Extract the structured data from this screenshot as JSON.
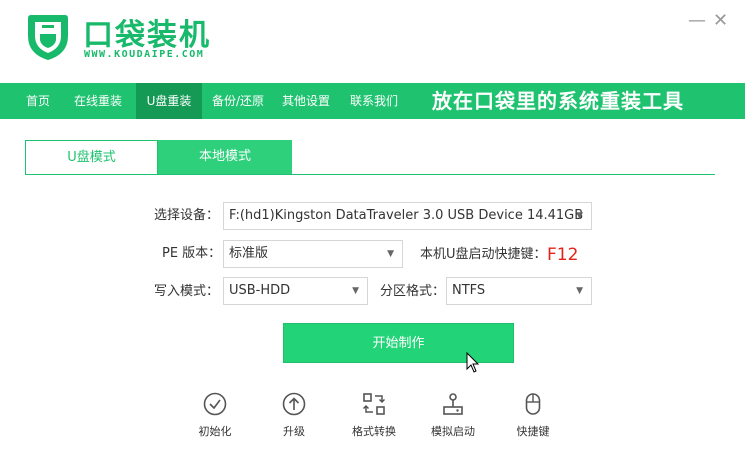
{
  "app": {
    "title": "口袋装机",
    "url": "WWW.KOUDAIPE.COM",
    "minimize_glyph": "—",
    "close_glyph": "✕"
  },
  "nav": {
    "items": [
      {
        "label": "首页"
      },
      {
        "label": "在线重装"
      },
      {
        "label": "U盘重装"
      },
      {
        "label": "备份/还原"
      },
      {
        "label": "其他设置"
      },
      {
        "label": "联系我们"
      }
    ],
    "active_index": 2,
    "slogan": "放在口袋里的系统重装工具"
  },
  "tabs": [
    {
      "label": "U盘模式"
    },
    {
      "label": "本地模式"
    }
  ],
  "form": {
    "device_label": "选择设备：",
    "device_value": "F:(hd1)Kingston DataTraveler 3.0 USB Device 14.41GB",
    "pe_label": "PE 版本：",
    "pe_value": "标准版",
    "hotkey_label": "本机U盘启动快捷键：",
    "hotkey_value": "F12",
    "write_label": "写入模式：",
    "write_value": "USB-HDD",
    "partition_label": "分区格式：",
    "partition_value": "NTFS"
  },
  "start_button": "开始制作",
  "tools": [
    {
      "label": "初始化",
      "icon": "check-circle-icon"
    },
    {
      "label": "升级",
      "icon": "arrow-up-circle-icon"
    },
    {
      "label": "格式转换",
      "icon": "convert-icon"
    },
    {
      "label": "模拟启动",
      "icon": "joystick-icon"
    },
    {
      "label": "快捷键",
      "icon": "mouse-icon"
    }
  ],
  "colors": {
    "brand_green": "#1fc36f",
    "nav_active": "#149a55",
    "button_green": "#22d378",
    "hotkey_red": "#e2231a"
  }
}
